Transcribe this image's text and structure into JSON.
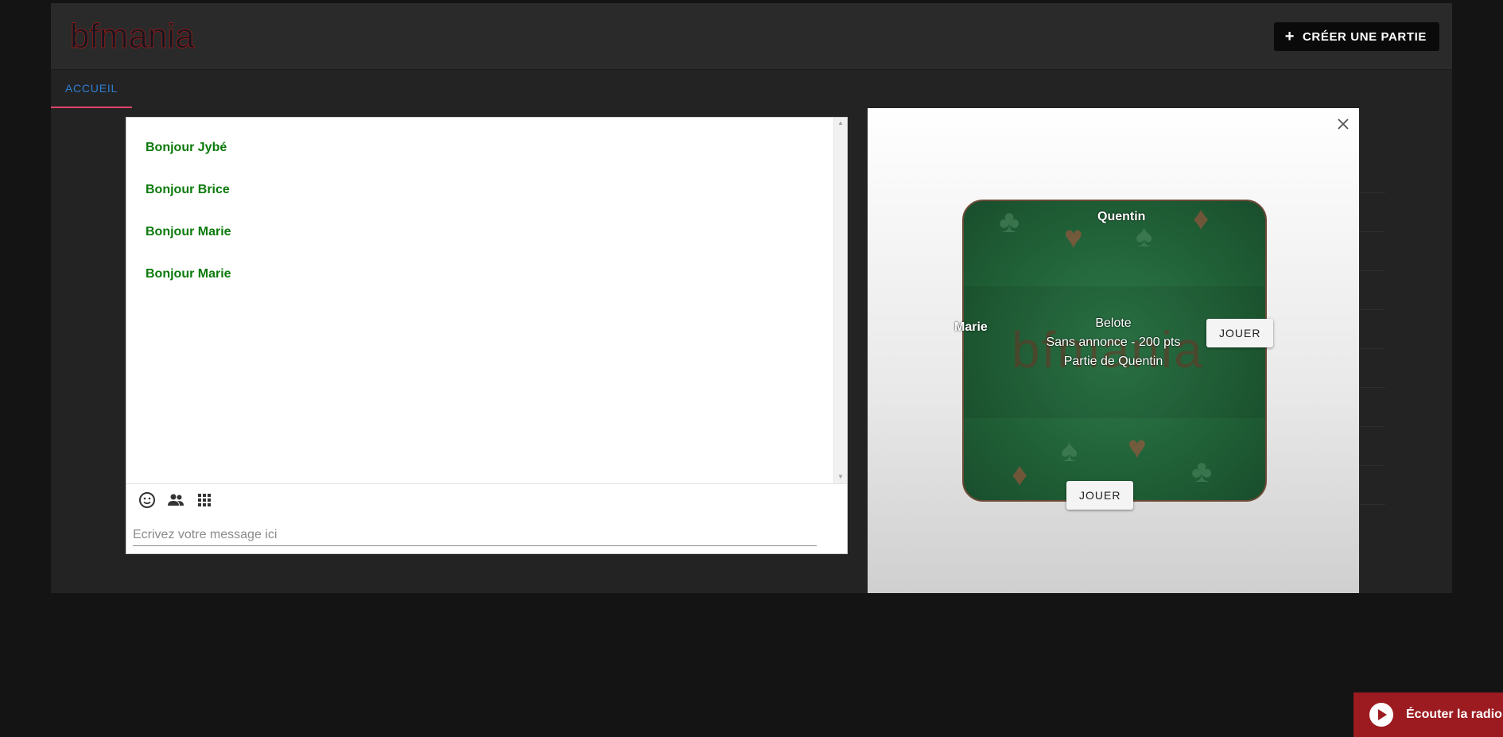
{
  "header": {
    "logo_text": "bfmania",
    "create_button_label": "CRÉER UNE PARTIE"
  },
  "tabs": [
    {
      "label": "ACCUEIL",
      "active": true
    }
  ],
  "chat": {
    "messages": [
      "Bonjour Jybé",
      "Bonjour Brice",
      "Bonjour Marie",
      "Bonjour Marie"
    ],
    "toolbar_icons": [
      "smiley-icon",
      "people-icon",
      "apps-icon"
    ],
    "input_placeholder": "Ecrivez votre message ici"
  },
  "game_panel": {
    "players": {
      "top": "Quentin",
      "left": "Marie"
    },
    "game_type": "Belote",
    "rules": "Sans annonce - 200 pts",
    "owner": "Partie de Quentin",
    "join_label": "JOUER",
    "table_color": "#1e5c34"
  },
  "radio": {
    "label": "Écouter la radio",
    "color": "#9b1b20"
  }
}
